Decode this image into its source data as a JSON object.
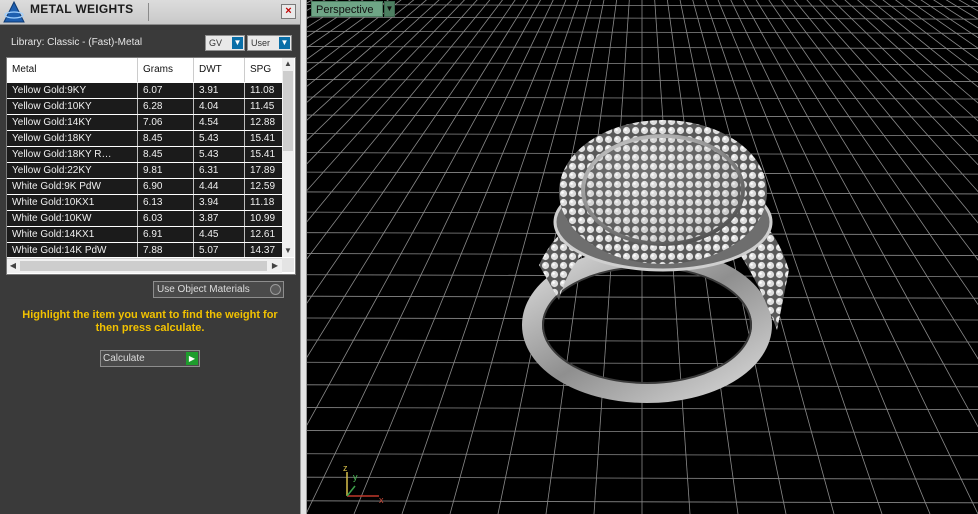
{
  "panel": {
    "title": "METAL WEIGHTS",
    "close_glyph": "×",
    "library_label": "Library: Classic - (Fast)-Metal",
    "gv_select": "GV",
    "user_select": "User",
    "table": {
      "headers": [
        "Metal",
        "Grams",
        "DWT",
        "SPG"
      ],
      "rows": [
        [
          "Yellow Gold:9KY",
          "6.07",
          "3.91",
          "11.08"
        ],
        [
          "Yellow Gold:10KY",
          "6.28",
          "4.04",
          "11.45"
        ],
        [
          "Yellow Gold:14KY",
          "7.06",
          "4.54",
          "12.88"
        ],
        [
          "Yellow Gold:18KY",
          "8.45",
          "5.43",
          "15.41"
        ],
        [
          "Yellow Gold:18KY R…",
          "8.45",
          "5.43",
          "15.41"
        ],
        [
          "Yellow Gold:22KY",
          "9.81",
          "6.31",
          "17.89"
        ],
        [
          "White Gold:9K PdW",
          "6.90",
          "4.44",
          "12.59"
        ],
        [
          "White Gold:10KX1",
          "6.13",
          "3.94",
          "11.18"
        ],
        [
          "White Gold:10KW",
          "6.03",
          "3.87",
          "10.99"
        ],
        [
          "White Gold:14KX1",
          "6.91",
          "4.45",
          "12.61"
        ],
        [
          "White Gold:14K PdW",
          "7.88",
          "5.07",
          "14.37"
        ]
      ]
    },
    "use_object_materials_label": "Use Object Materials",
    "hint": "Highlight the item you want to find the weight for then press calculate.",
    "calculate_label": "Calculate"
  },
  "viewport": {
    "view_name": "Perspective",
    "axis_labels": {
      "z": "z",
      "y": "y",
      "x": "x"
    }
  },
  "colors": {
    "accent_blue": "#0a6fa8",
    "hint_yellow": "#f2c200",
    "go_green": "#1e9d2d",
    "viewport_tab": "#6fa586"
  },
  "icons": {
    "logo": "app-logo-icon",
    "close": "close-icon",
    "dropdown": "chevron-down-icon",
    "go": "play-arrow-icon"
  }
}
